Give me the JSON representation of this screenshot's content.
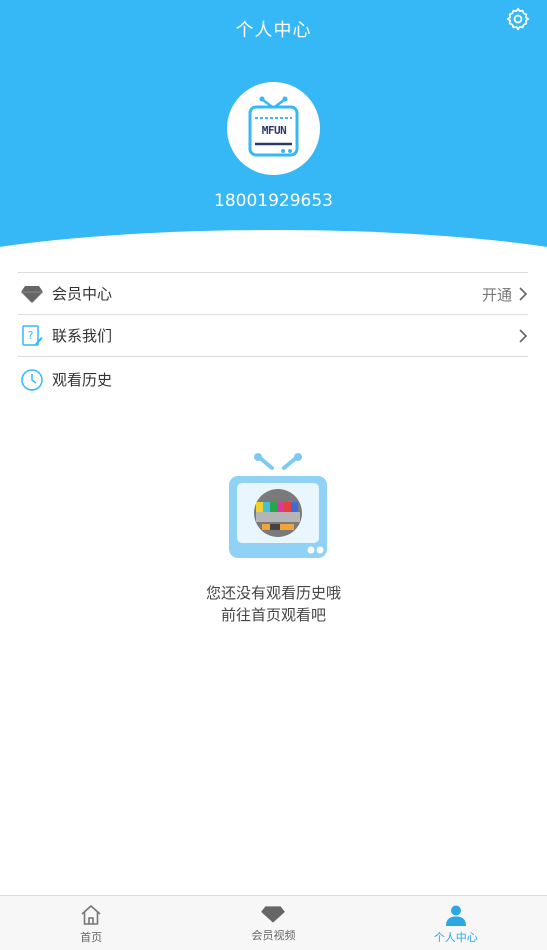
{
  "header": {
    "title": "个人中心",
    "phone": "18001929653",
    "settings_icon": "gear-icon",
    "avatar_logo_text": "MFUN",
    "background_color": "#36b8f6"
  },
  "menu": {
    "items": [
      {
        "label": "会员中心",
        "right_text": "开通",
        "icon": "diamond-icon"
      },
      {
        "label": "联系我们",
        "right_text": "",
        "icon": "help-doc-icon"
      },
      {
        "label": "观看历史",
        "right_text": "",
        "icon": "clock-icon"
      }
    ]
  },
  "empty_state": {
    "line1": "您还没有观看历史哦",
    "line2": "前往首页观看吧",
    "icon": "tv-test-pattern-icon"
  },
  "tabbar": {
    "tabs": [
      {
        "label": "首页",
        "icon": "home-icon",
        "active": false
      },
      {
        "label": "会员视频",
        "icon": "diamond-icon",
        "active": false
      },
      {
        "label": "个人中心",
        "icon": "user-icon",
        "active": true
      }
    ],
    "active_color": "#2aa8e6"
  }
}
